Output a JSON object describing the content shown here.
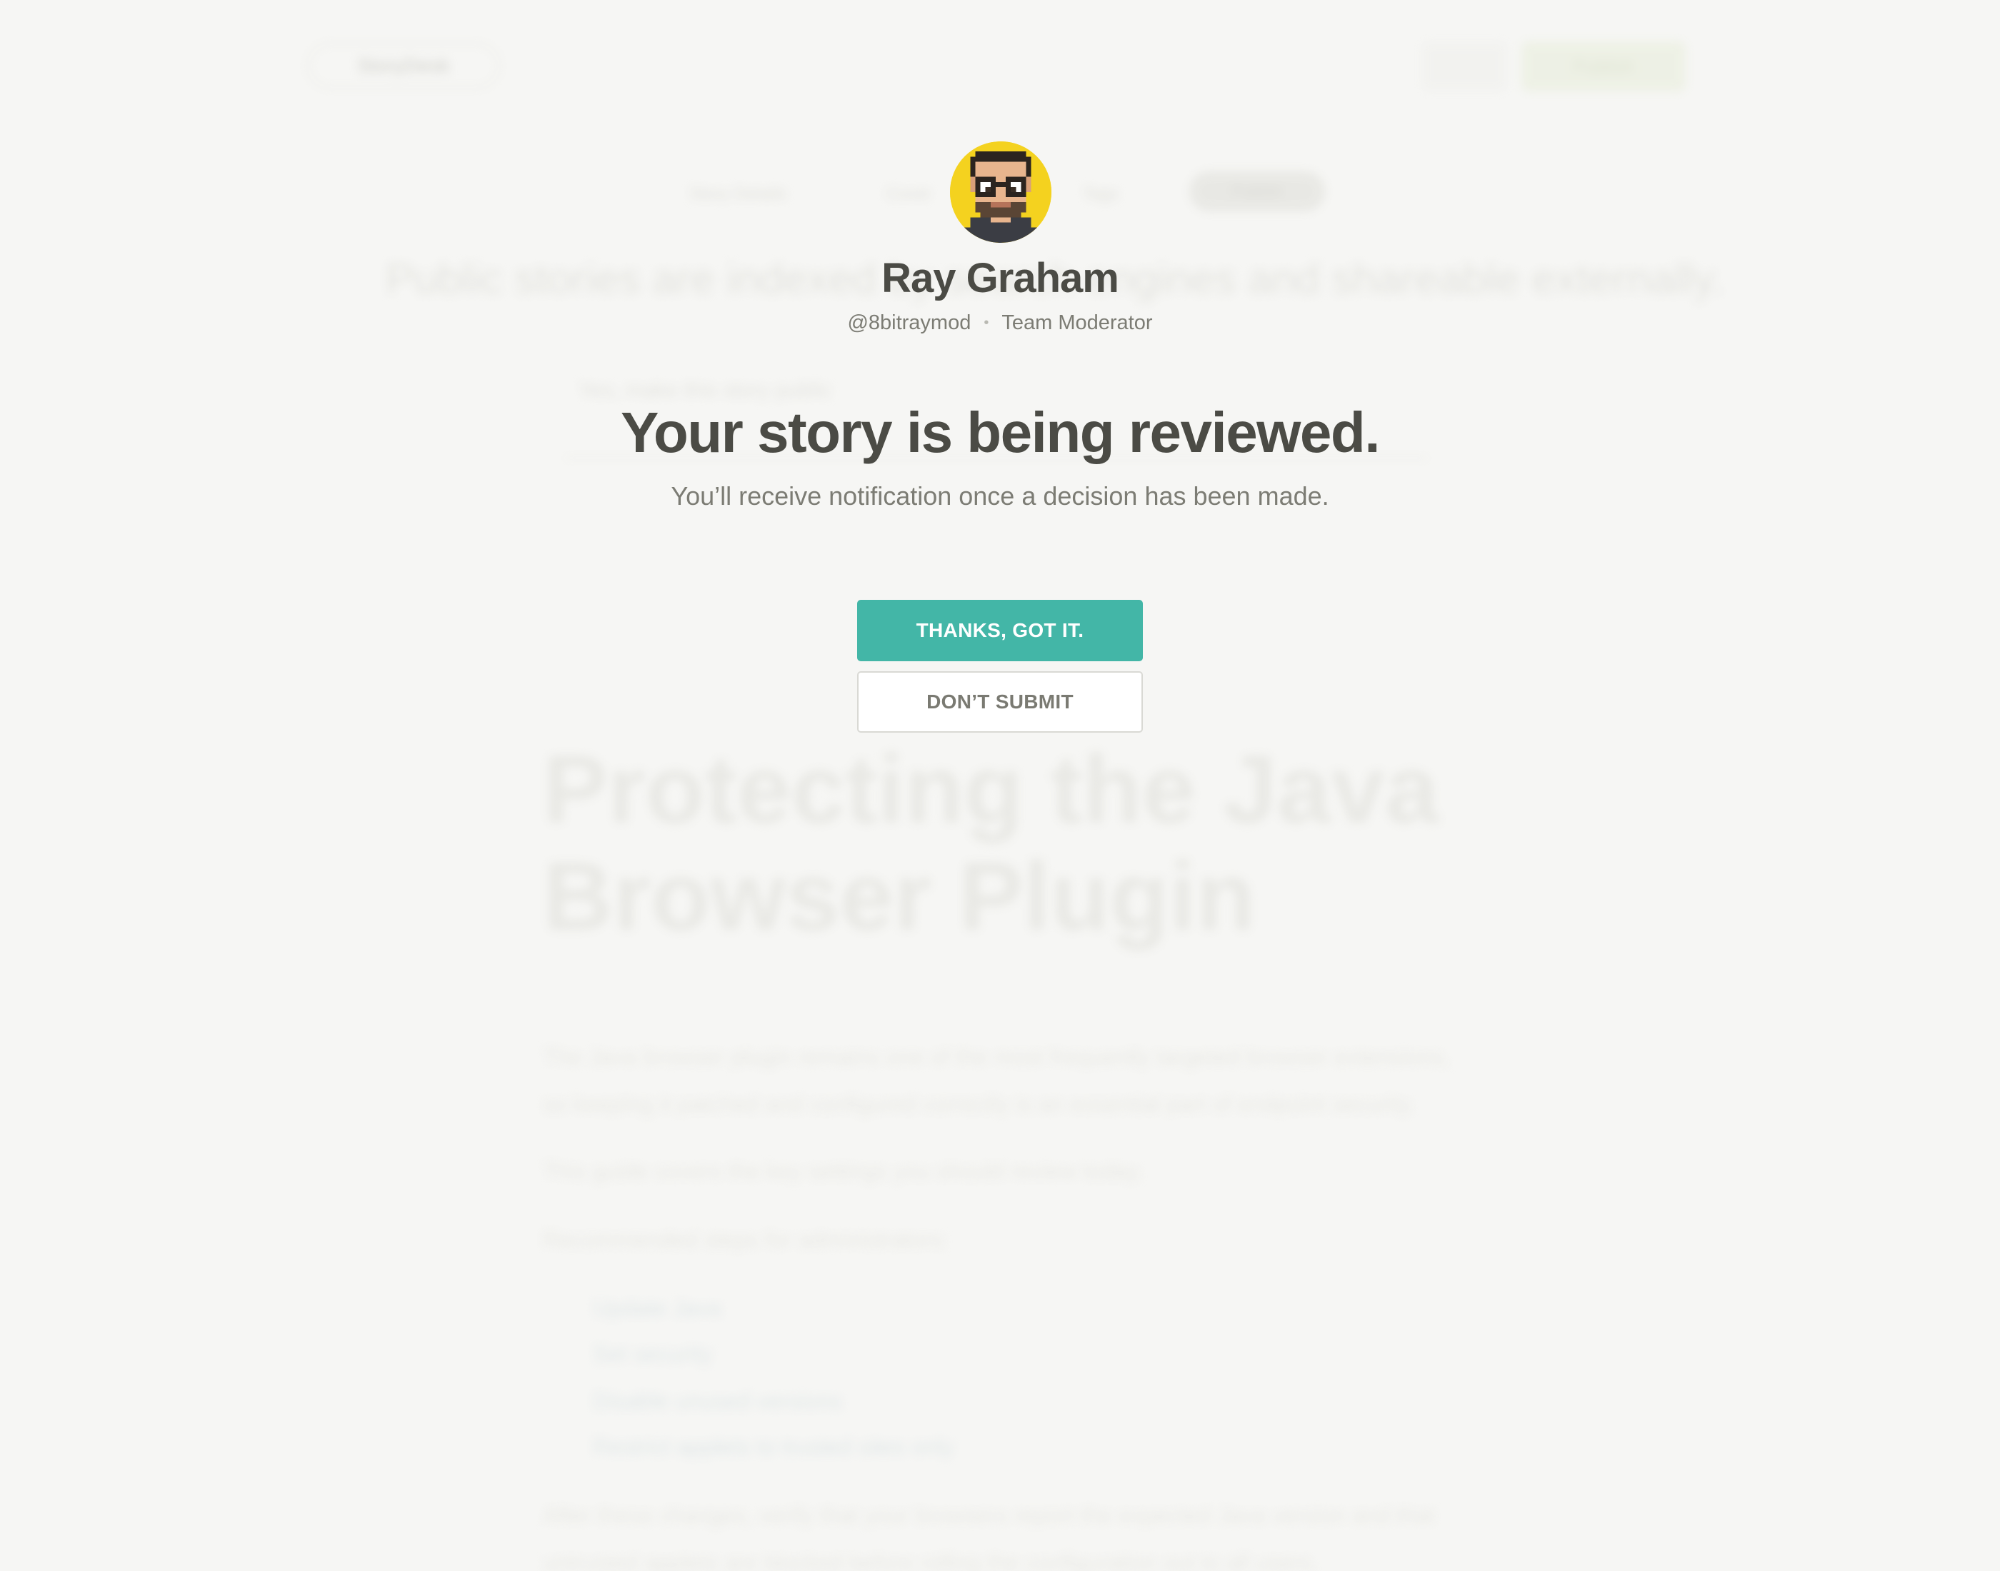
{
  "background_page": {
    "brand": "StoryDesk",
    "nav_primary_label": "Publish",
    "steps": [
      "Story Details",
      "Cover",
      "Tags",
      "Publish"
    ],
    "visibility_heading": "Public stories are indexed by search engines and shareable externally.",
    "visibility_toggle": "Yes, make this story public",
    "story_title": "Protecting the Java Browser Plugin",
    "paragraph_lines": [
      "The Java browser plugin remains one of the most frequently targeted browser extensions,",
      "so keeping it patched and configured correctly is an essential part of endpoint security.",
      "This guide covers the key settings you should review today.",
      "Recommended steps for administrators:"
    ],
    "bullets": [
      "Update Java",
      "Set security",
      "Disable unused versions",
      "Restrict applets to trusted sites only"
    ],
    "closing_lines": [
      "After these changes, verify that your browsers report the expected Java version and that",
      "untrusted applets are blocked before rolling the configuration out to all users."
    ]
  },
  "profile": {
    "name": "Ray Graham",
    "handle": "@8bitraymod",
    "separator": "•",
    "role": "Team Moderator",
    "avatar_icon": "pixel-avatar-icon",
    "avatar_color": "#f4d21f"
  },
  "review": {
    "title": "Your story is being reviewed.",
    "subtitle": "You’ll receive notification once a decision has been made."
  },
  "actions": {
    "confirm_label": "THANKS, GOT IT.",
    "cancel_label": "DON’T SUBMIT",
    "accent_color": "#43b6a7"
  }
}
